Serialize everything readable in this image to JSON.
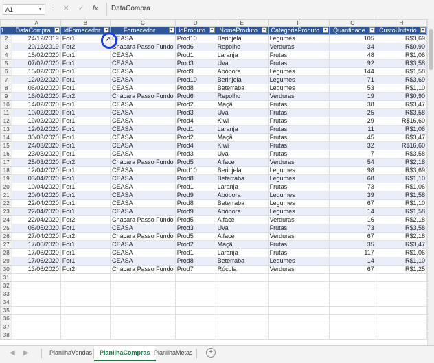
{
  "formula_bar": {
    "name_box": "A1",
    "fx_label": "fx",
    "value": "DataCompra"
  },
  "columns": [
    "A",
    "B",
    "C",
    "D",
    "E",
    "F",
    "G",
    "H"
  ],
  "headers": [
    "DataCompra",
    "idFornecedor",
    "Fornecedor",
    "idProduto",
    "NomeProduto",
    "CategoriaProduto",
    "Quantidade",
    "CustoUnitario"
  ],
  "rows": [
    [
      "24/12/2019",
      "For1",
      "CEASA",
      "Prod10",
      "Berinjela",
      "Legumes",
      "105",
      "R$3,69"
    ],
    [
      "20/12/2019",
      "For2",
      "Chácara Passo Fundo",
      "Prod6",
      "Repolho",
      "Verduras",
      "34",
      "R$0,90"
    ],
    [
      "15/02/2020",
      "For1",
      "CEASA",
      "Prod1",
      "Laranja",
      "Frutas",
      "48",
      "R$1,06"
    ],
    [
      "07/02/2020",
      "For1",
      "CEASA",
      "Prod3",
      "Uva",
      "Frutas",
      "92",
      "R$3,58"
    ],
    [
      "15/02/2020",
      "For1",
      "CEASA",
      "Prod9",
      "Abóbora",
      "Legumes",
      "144",
      "R$1,58"
    ],
    [
      "12/02/2020",
      "For1",
      "CEASA",
      "Prod10",
      "Berinjela",
      "Legumes",
      "71",
      "R$3,69"
    ],
    [
      "06/02/2020",
      "For1",
      "CEASA",
      "Prod8",
      "Beterraba",
      "Legumes",
      "53",
      "R$1,10"
    ],
    [
      "16/02/2020",
      "For2",
      "Chácara Passo Fundo",
      "Prod6",
      "Repolho",
      "Verduras",
      "19",
      "R$0,90"
    ],
    [
      "14/02/2020",
      "For1",
      "CEASA",
      "Prod2",
      "Maçã",
      "Frutas",
      "38",
      "R$3,47"
    ],
    [
      "10/02/2020",
      "For1",
      "CEASA",
      "Prod3",
      "Uva",
      "Frutas",
      "25",
      "R$3,58"
    ],
    [
      "19/02/2020",
      "For1",
      "CEASA",
      "Prod4",
      "Kiwi",
      "Frutas",
      "29",
      "R$16,60"
    ],
    [
      "12/02/2020",
      "For1",
      "CEASA",
      "Prod1",
      "Laranja",
      "Frutas",
      "11",
      "R$1,06"
    ],
    [
      "30/03/2020",
      "For1",
      "CEASA",
      "Prod2",
      "Maçã",
      "Frutas",
      "45",
      "R$3,47"
    ],
    [
      "24/03/2020",
      "For1",
      "CEASA",
      "Prod4",
      "Kiwi",
      "Frutas",
      "32",
      "R$16,60"
    ],
    [
      "23/03/2020",
      "For1",
      "CEASA",
      "Prod3",
      "Uva",
      "Frutas",
      "7",
      "R$3,58"
    ],
    [
      "25/03/2020",
      "For2",
      "Chácara Passo Fundo",
      "Prod5",
      "Alface",
      "Verduras",
      "54",
      "R$2,18"
    ],
    [
      "12/04/2020",
      "For1",
      "CEASA",
      "Prod10",
      "Berinjela",
      "Legumes",
      "98",
      "R$3,69"
    ],
    [
      "03/04/2020",
      "For1",
      "CEASA",
      "Prod8",
      "Beterraba",
      "Legumes",
      "68",
      "R$1,10"
    ],
    [
      "10/04/2020",
      "For1",
      "CEASA",
      "Prod1",
      "Laranja",
      "Frutas",
      "73",
      "R$1,06"
    ],
    [
      "20/04/2020",
      "For1",
      "CEASA",
      "Prod9",
      "Abóbora",
      "Legumes",
      "39",
      "R$1,58"
    ],
    [
      "22/04/2020",
      "For1",
      "CEASA",
      "Prod8",
      "Beterraba",
      "Legumes",
      "67",
      "R$1,10"
    ],
    [
      "22/04/2020",
      "For1",
      "CEASA",
      "Prod9",
      "Abóbora",
      "Legumes",
      "14",
      "R$1,58"
    ],
    [
      "22/04/2020",
      "For2",
      "Chácara Passo Fundo",
      "Prod5",
      "Alface",
      "Verduras",
      "16",
      "R$2,18"
    ],
    [
      "05/05/2020",
      "For1",
      "CEASA",
      "Prod3",
      "Uva",
      "Frutas",
      "73",
      "R$3,58"
    ],
    [
      "27/04/2020",
      "For2",
      "Chácara Passo Fundo",
      "Prod5",
      "Alface",
      "Verduras",
      "67",
      "R$2,18"
    ],
    [
      "17/06/2020",
      "For1",
      "CEASA",
      "Prod2",
      "Maçã",
      "Frutas",
      "35",
      "R$3,47"
    ],
    [
      "17/06/2020",
      "For1",
      "CEASA",
      "Prod1",
      "Laranja",
      "Frutas",
      "117",
      "R$1,06"
    ],
    [
      "17/06/2020",
      "For1",
      "CEASA",
      "Prod8",
      "Beterraba",
      "Legumes",
      "14",
      "R$1,10"
    ],
    [
      "13/06/2020",
      "For2",
      "Chácara Passo Fundo",
      "Prod7",
      "Rúcula",
      "Verduras",
      "67",
      "R$1,25"
    ]
  ],
  "empty_rows": [
    31,
    32,
    33,
    34,
    35,
    36,
    37,
    38
  ],
  "sheet_tabs": [
    "PlanilhaVendas",
    "PlanilhaCompras",
    "PlanilhaMetas"
  ],
  "active_tab": 1,
  "colors": {
    "header_bg": "#2f5597",
    "band_bg": "#e9eef8",
    "active_tab": "#217346",
    "cursor_ring": "#1a3cd8"
  }
}
